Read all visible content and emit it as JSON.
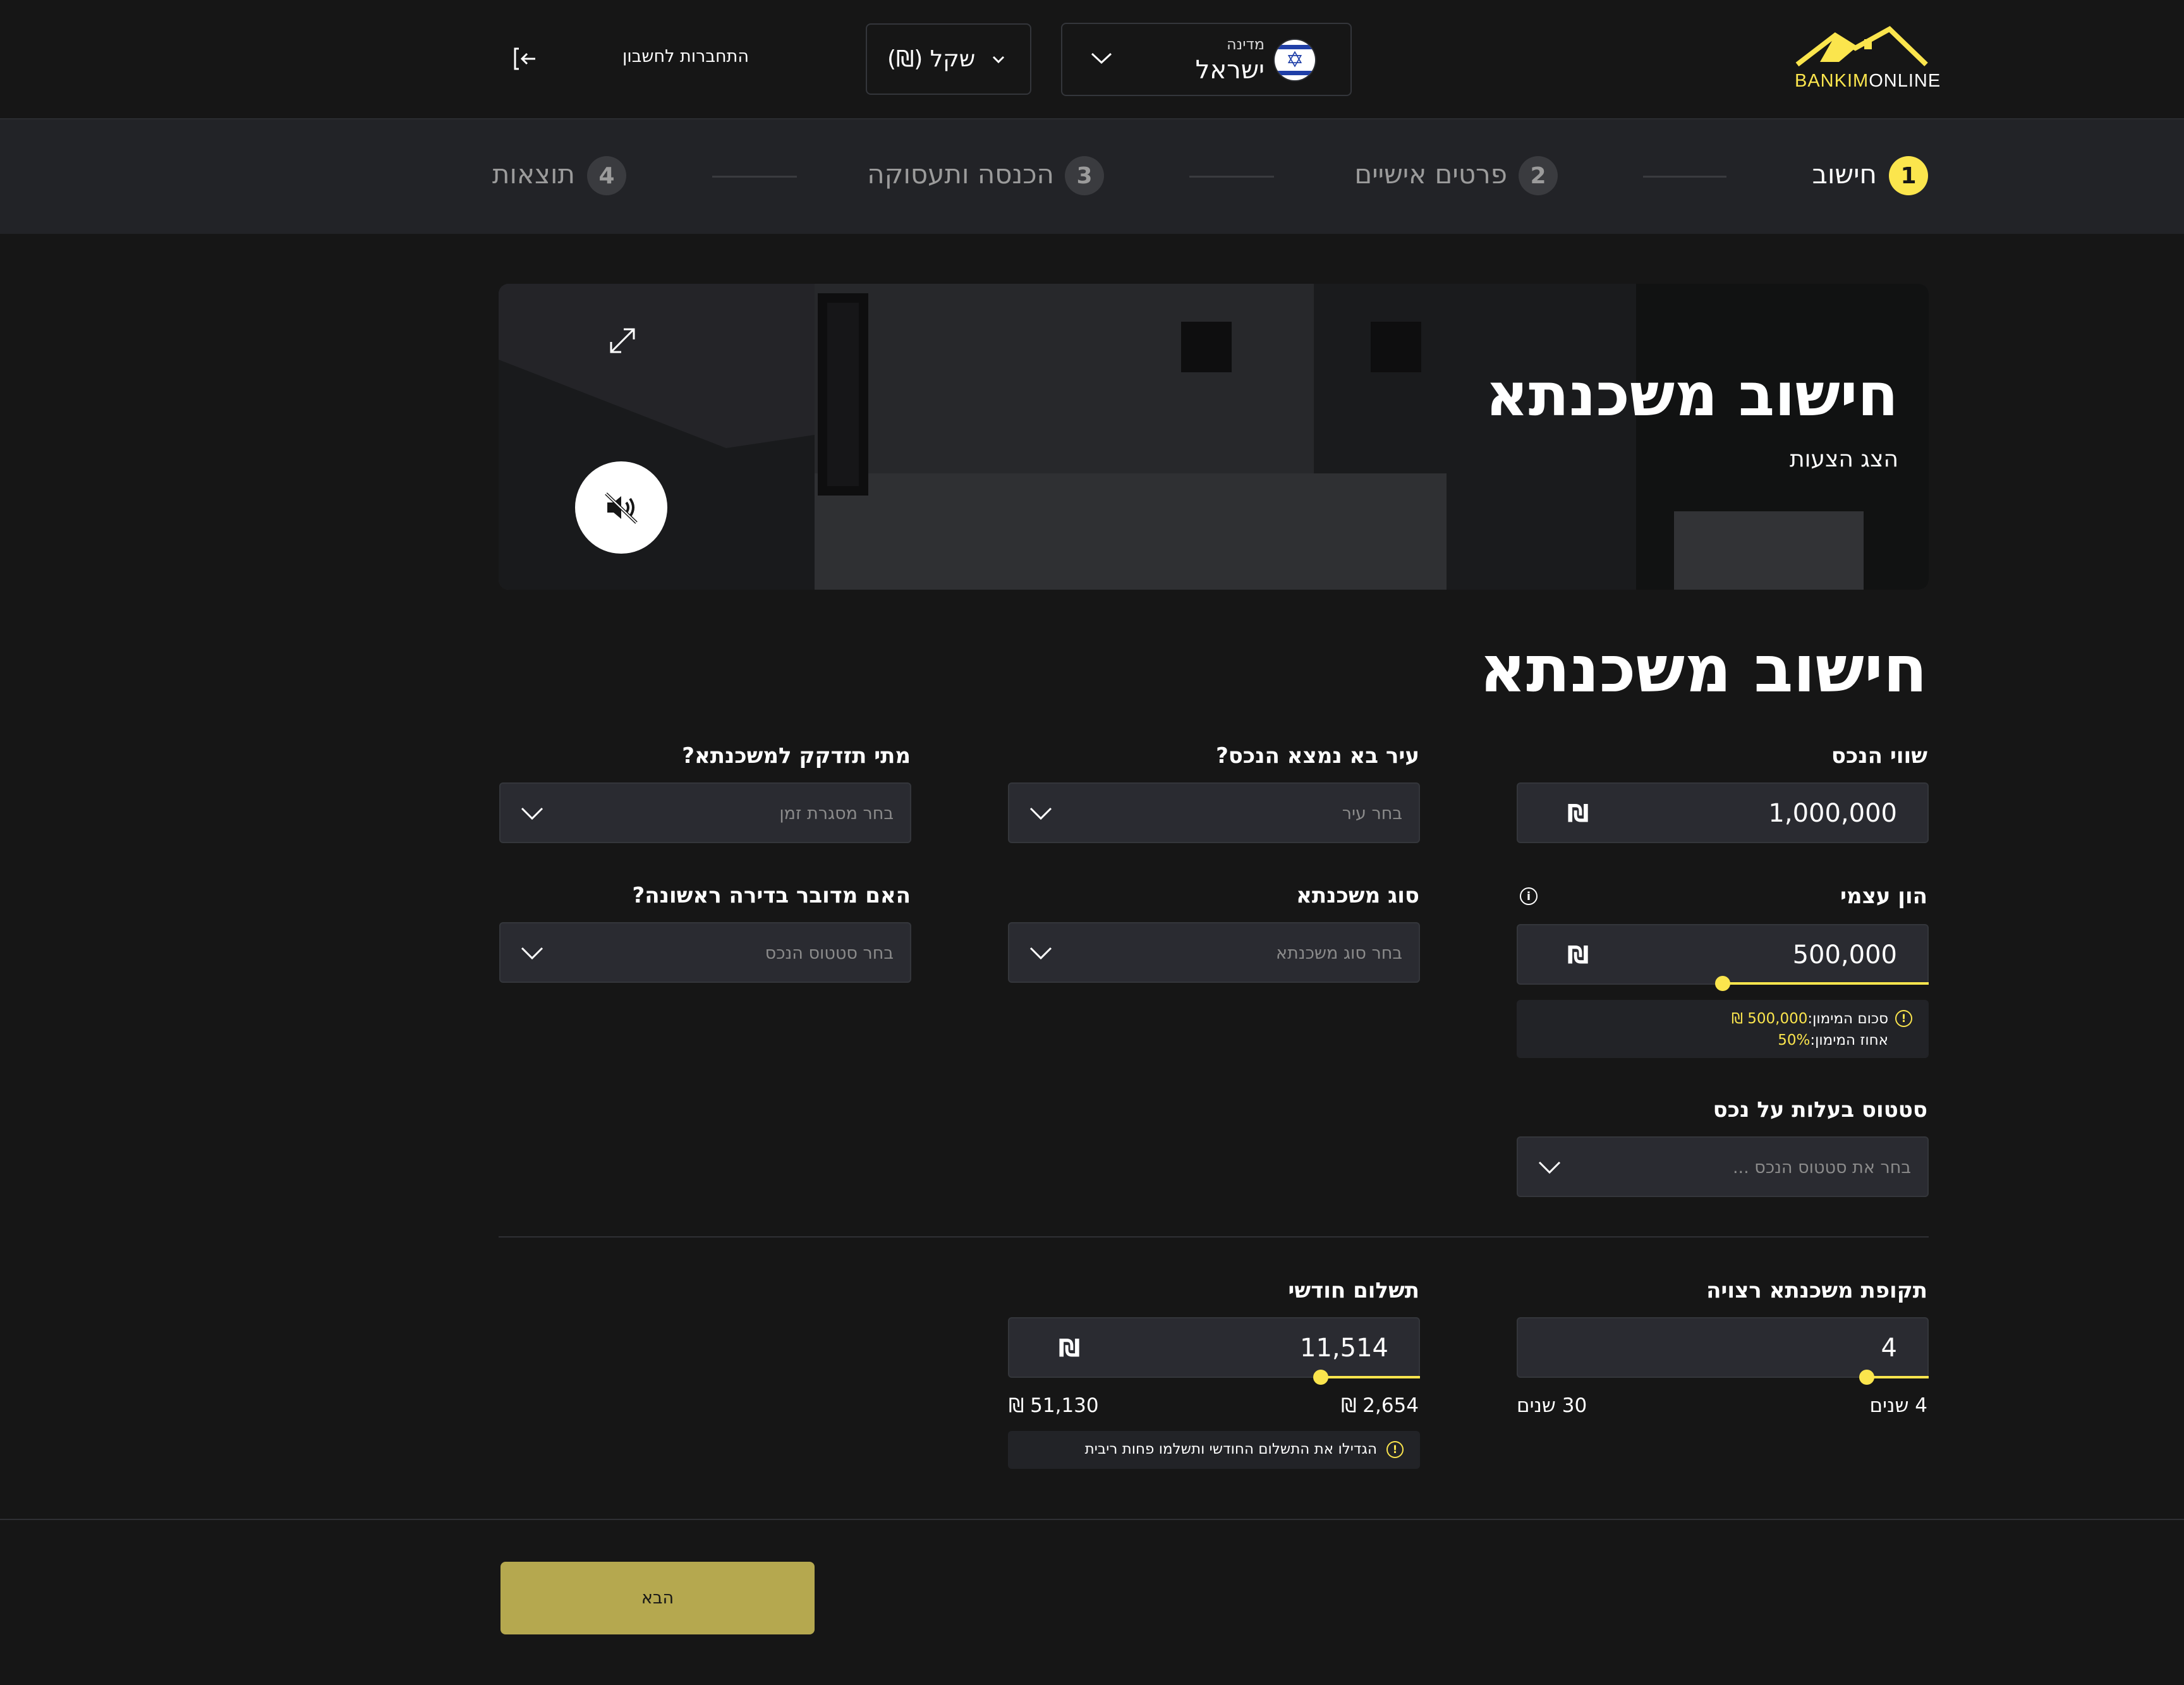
{
  "header": {
    "logo": {
      "part1": "BANKIM",
      "part2": "ONLINE"
    },
    "country": {
      "label": "מדינה",
      "value": "ישראל"
    },
    "currency": {
      "value": "שקל (₪)"
    },
    "login": {
      "label": "התחברות לחשבון"
    }
  },
  "steps": [
    {
      "num": "1",
      "label": "חישוב",
      "active": true
    },
    {
      "num": "2",
      "label": "פרטים אישיים",
      "active": false
    },
    {
      "num": "3",
      "label": "הכנסה ותעסוקה",
      "active": false
    },
    {
      "num": "4",
      "label": "תוצאות",
      "active": false
    }
  ],
  "hero": {
    "title": "חישוב משכנתא",
    "subtitle": "הצג הצעות"
  },
  "form": {
    "title": "חישוב משכנתא",
    "property_value": {
      "label": "שווי הנכס",
      "value": "1,000,000",
      "currency": "₪"
    },
    "city": {
      "label": "עיר בא נמצא הנכס?",
      "placeholder": "בחר עיר"
    },
    "when_needed": {
      "label": "מתי תזדקק למשכנתא?",
      "placeholder": "בחר מסגרת זמן"
    },
    "equity": {
      "label": "הון עצמי",
      "value": "500,000",
      "currency": "₪",
      "slider_fraction": 0.5,
      "note_financing_label": "סכום המימון:",
      "note_financing_value": "500,000 ₪",
      "note_percent_label": "אחוז המימון:",
      "note_percent_value": "50%"
    },
    "mortgage_type": {
      "label": "סוג משכנתא",
      "placeholder": "בחר סוג משכנתא"
    },
    "first_apartment": {
      "label": "האם מדובר בדירה ראשונה?",
      "placeholder": "בחר סטטוס הנכס"
    },
    "ownership": {
      "label": "סטטוס בעלות על נכס",
      "placeholder": "בחר את סטטוס הנכס ..."
    },
    "period": {
      "label": "תקופת משכנתא רצויה",
      "value": "4",
      "slider_fraction": 0.0,
      "min_label": "4 שנים",
      "max_label": "30 שנים"
    },
    "monthly": {
      "label": "תשלום חודשי",
      "value": "11,514",
      "currency": "₪",
      "slider_fraction": 0.18,
      "min_label": "₪ 2,654",
      "max_label": "₪ 51,130",
      "note": "הגדילו את התשלום החודשי ותשלמו פחות ריבית"
    },
    "next_button": "הבא"
  },
  "colors": {
    "accent": "#fbe54d",
    "background": "#161616",
    "input_bg": "#2a2b31",
    "button": "#b5a84f"
  },
  "icons": [
    "logout-icon",
    "chevron-down-icon",
    "israel-flag-icon",
    "expand-icon",
    "mute-icon",
    "info-icon",
    "warning-icon"
  ]
}
